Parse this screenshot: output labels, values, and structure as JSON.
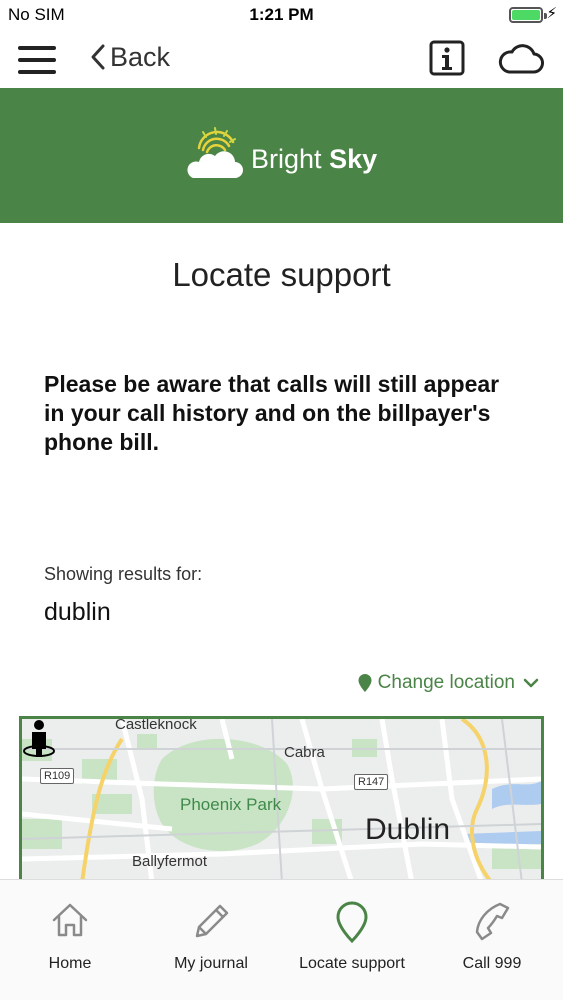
{
  "status_bar": {
    "carrier": "No SIM",
    "time": "1:21 PM"
  },
  "nav": {
    "back_label": "Back",
    "menu_icon": "hamburger-menu-icon",
    "info_icon": "info-icon",
    "cloud_icon": "cloud-icon"
  },
  "brand": {
    "name_regular": "Bright",
    "name_bold": "Sky",
    "color": "#4a8446"
  },
  "page": {
    "title": "Locate support",
    "warning": "Please be aware that calls will still appear in your call history and on the billpayer's phone bill.",
    "results_label": "Showing results for:",
    "results_value": "dublin",
    "change_location_label": "Change location"
  },
  "map": {
    "labels": {
      "castleknock": "Castleknock",
      "cabra": "Cabra",
      "phoenix_park": "Phoenix Park",
      "dublin": "Dublin",
      "ballyfermot": "Ballyfermot"
    },
    "roads": {
      "r109": "R109",
      "r147": "R147"
    }
  },
  "tabs": [
    {
      "label": "Home",
      "icon": "home-icon"
    },
    {
      "label": "My journal",
      "icon": "pencil-icon"
    },
    {
      "label": "Locate support",
      "icon": "location-pin-icon"
    },
    {
      "label": "Call 999",
      "icon": "phone-icon"
    }
  ]
}
